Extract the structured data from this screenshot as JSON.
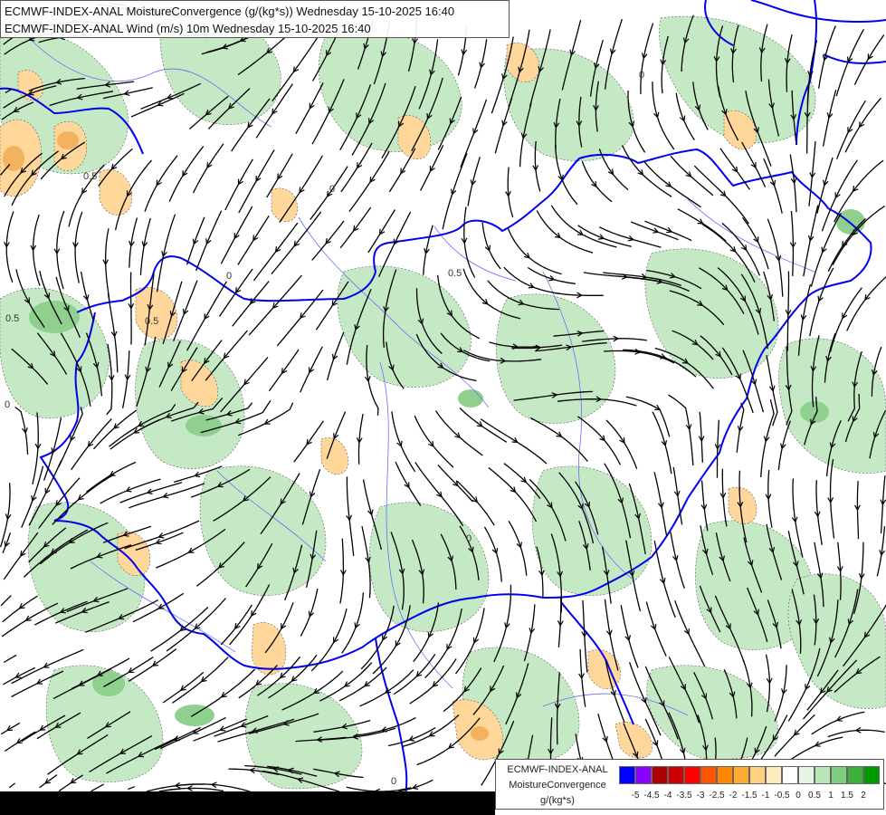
{
  "title": {
    "line1": "ECMWF-INDEX-ANAL MoistureConvergence (g/(kg*s)) Wednesday 15-10-2025 16:40",
    "line2": "ECMWF-INDEX-ANAL Wind (m/s) 10m Wednesday 15-10-2025 16:40"
  },
  "legend": {
    "line1": "ECMWF-INDEX-ANAL",
    "line2": "MoistureConvergence",
    "unit": "g/(kg*s)",
    "colors": [
      "#0000ff",
      "#8800ff",
      "#aa0000",
      "#cc0000",
      "#ff0000",
      "#ff5500",
      "#ff8800",
      "#ffaa33",
      "#ffd080",
      "#ffebc0",
      "#ffffff",
      "#e6f6e6",
      "#b8e6b8",
      "#7fcf7f",
      "#3fb03f",
      "#009900"
    ],
    "ticks": [
      "-5",
      "-4.5",
      "-4",
      "-3.5",
      "-3",
      "-2.5",
      "-2",
      "-1.5",
      "-1",
      "-0.5",
      "0",
      "0.5",
      "1",
      "1.5",
      "2"
    ]
  },
  "map": {
    "contour_labels": [
      {
        "text": "0.5"
      },
      {
        "text": "0.5"
      },
      {
        "text": "0.5"
      },
      {
        "text": "0.5"
      },
      {
        "text": "0"
      },
      {
        "text": "0"
      },
      {
        "text": "0"
      },
      {
        "text": "0"
      },
      {
        "text": "0"
      },
      {
        "text": "0"
      }
    ],
    "colors": {
      "border": "#0000ee",
      "river": "#6a6aff",
      "streamline": "#000000",
      "green_light": "#cbeccb",
      "green_mid": "#9fd99f",
      "orange_light": "#ffdca0",
      "orange_mid": "#f5b96a"
    }
  }
}
